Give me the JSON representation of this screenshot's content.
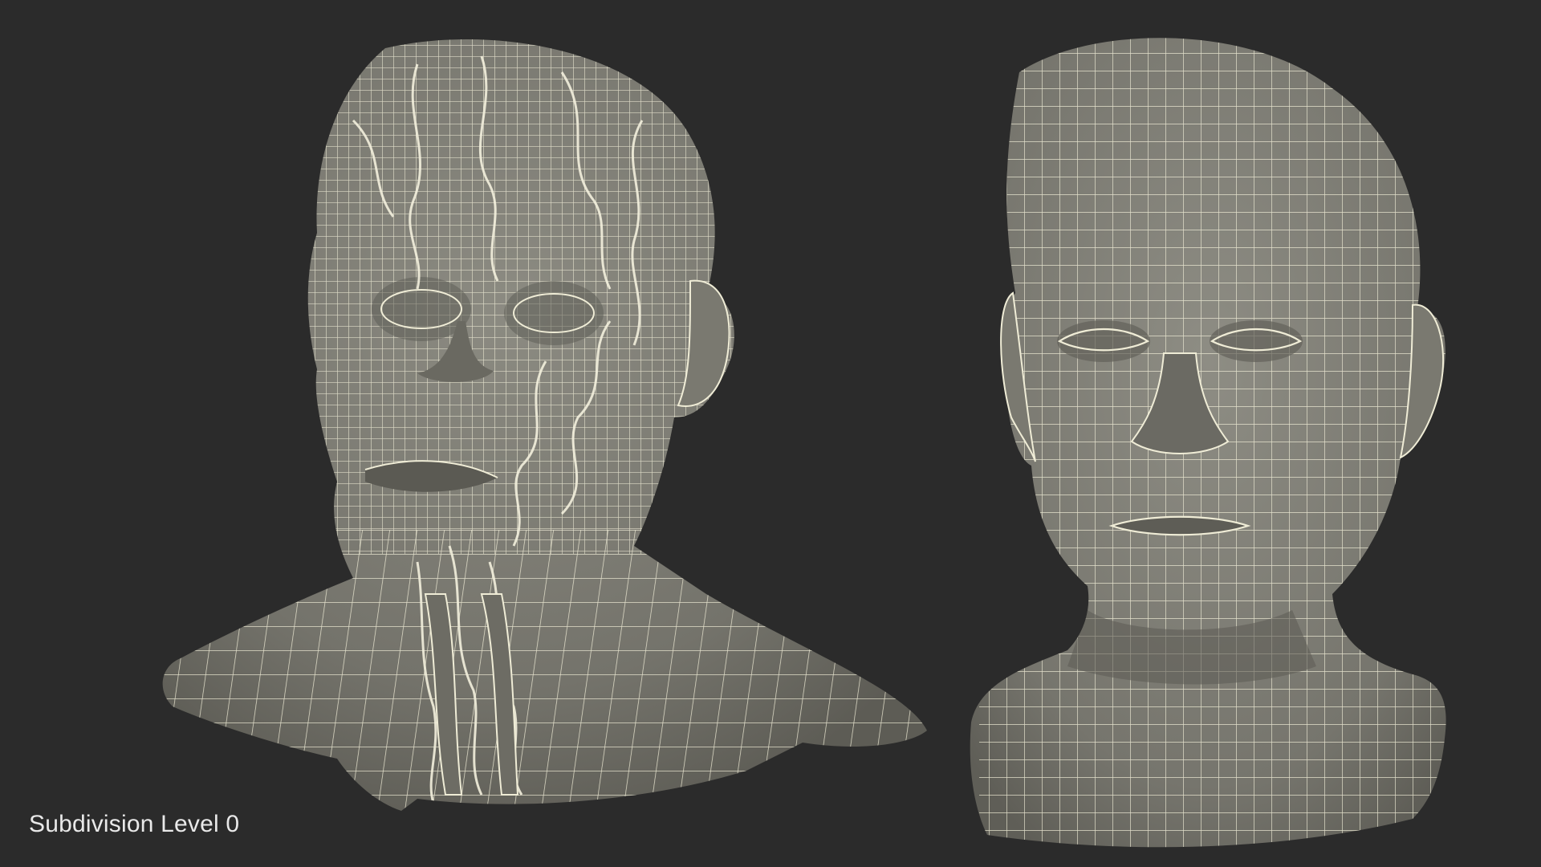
{
  "caption": "Subdivision Level 0",
  "background_color": "#2b2b2b",
  "surface_color": "#7c7b72",
  "wire_color": "#efecd6",
  "models": [
    {
      "id": "anatomy-head",
      "description_icon": "anatomical-head-wireframe"
    },
    {
      "id": "skin-head",
      "description_icon": "skin-head-wireframe"
    }
  ]
}
